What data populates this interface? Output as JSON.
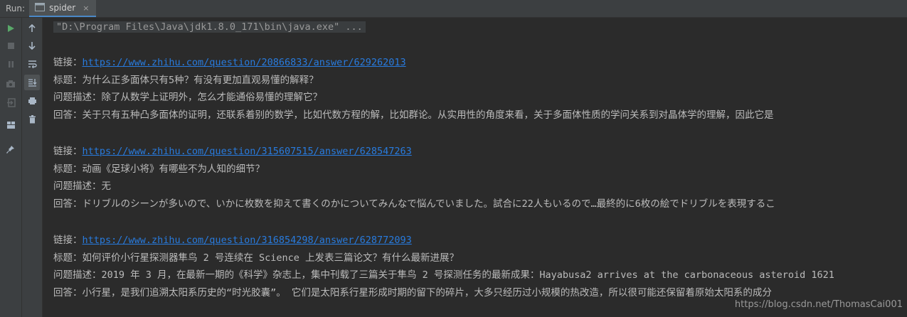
{
  "tabbar": {
    "run_label": "Run:",
    "tab_label": "spider",
    "tab_close": "×"
  },
  "console": {
    "cmd": "\"D:\\Program Files\\Java\\jdk1.8.0_171\\bin\\java.exe\" ...",
    "entries": [
      {
        "link_label": "链接：",
        "url": "https://www.zhihu.com/question/20866833/answer/629262013",
        "title": "标题：为什么正多面体只有5种？有没有更加直观易懂的解释？",
        "desc": "问题描述：除了从数学上证明外，怎么才能通俗易懂的理解它？",
        "answer": "回答：关于只有五种凸多面体的证明，还联系着别的数学，比如代数方程的解，比如群论。从实用性的角度来看，关于多面体性质的学问关系到对晶体学的理解，因此它是"
      },
      {
        "link_label": "链接：",
        "url": "https://www.zhihu.com/question/315607515/answer/628547263",
        "title": "标题：动画《足球小将》有哪些不为人知的细节？",
        "desc": "问题描述：无",
        "answer": "回答：ドリブルのシーンが多いので、いかに枚数を抑えて書くのかについてみんなで悩んでいました。試合に22人もいるので…最終的に6枚の絵でドリブルを表現するこ"
      },
      {
        "link_label": "链接：",
        "url": "https://www.zhihu.com/question/316854298/answer/628772093",
        "title": "标题：如何评价小行星探测器隼鸟 2 号连续在 Science 上发表三篇论文？有什么最新进展？",
        "desc": "问题描述：2019 年 3 月，在最新一期的《科学》杂志上，集中刊载了三篇关于隼鸟 2 号探测任务的最新成果：Hayabusa2 arrives at the carbonaceous asteroid 1621",
        "answer": "回答：小行星，是我们追溯太阳系历史的“时光胶囊”。 它们是太阳系行星形成时期的留下的碎片，大多只经历过小规模的热改造，所以很可能还保留着原始太阳系的成分"
      }
    ]
  },
  "watermark": "https://blog.csdn.net/ThomasCai001",
  "colors": {
    "link": "#287bde",
    "run_green": "#59a869",
    "text": "#bbbbbb"
  }
}
